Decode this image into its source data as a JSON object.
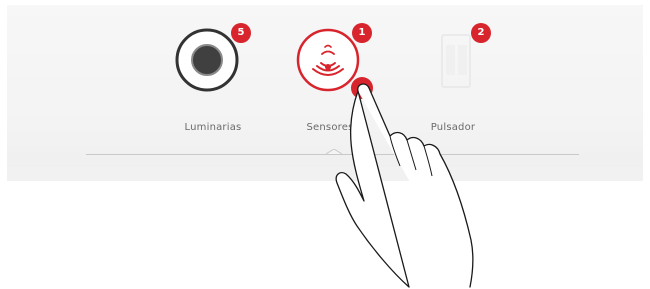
{
  "menu": {
    "items": [
      {
        "id": "luminarias",
        "label": "Luminarias",
        "badge": "5",
        "icon": "luminaire-icon"
      },
      {
        "id": "sensores",
        "label": "Sensores",
        "badge": "1",
        "icon": "sensor-icon",
        "selected": true
      },
      {
        "id": "pulsador",
        "label": "Pulsador",
        "badge": "2",
        "icon": "pushbutton-icon"
      }
    ]
  },
  "colors": {
    "accent": "#d8242c",
    "icon_dark": "#333333",
    "label": "#6a6a6a",
    "panel": "#f4f4f4"
  },
  "overlay": {
    "icon": "pointing-hand-icon"
  }
}
